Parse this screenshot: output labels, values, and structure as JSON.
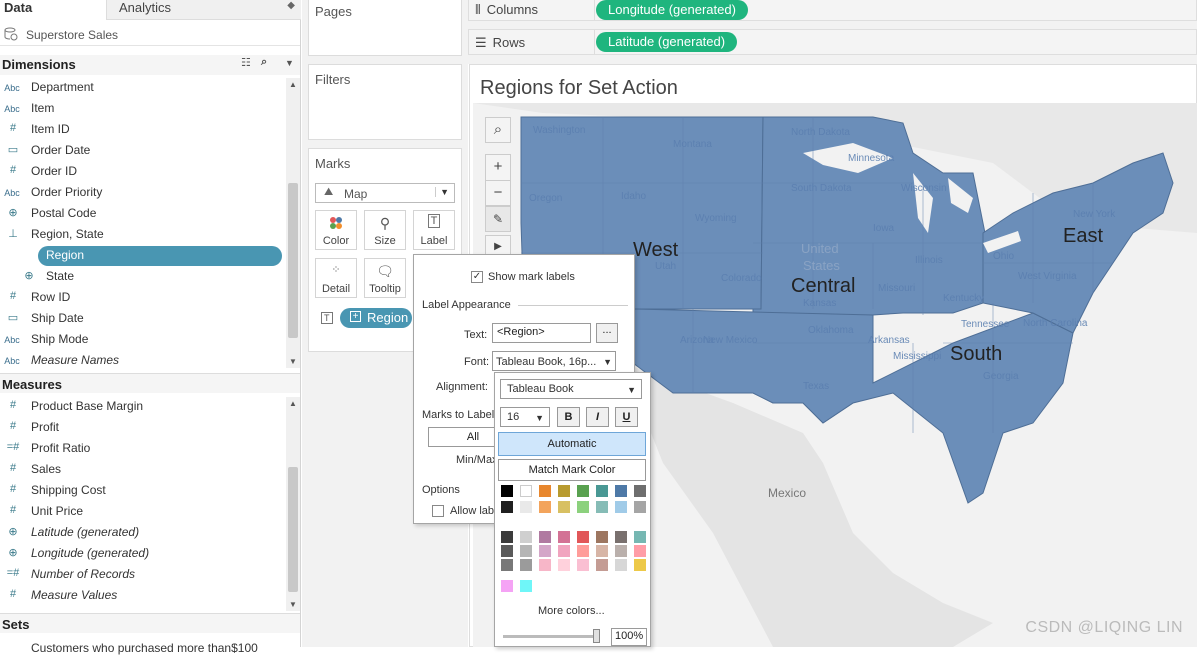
{
  "data_pane": {
    "tab_data": "Data",
    "tab_analytics": "Analytics",
    "datasource": "Superstore Sales",
    "dimensions_title": "Dimensions",
    "measures_title": "Measures",
    "sets_title": "Sets",
    "sets_item": "Customers who purchased more than$100",
    "dimensions": [
      {
        "icon": "Abc",
        "label": "Department"
      },
      {
        "icon": "Abc",
        "label": "Item"
      },
      {
        "icon": "#",
        "label": "Item ID"
      },
      {
        "icon": "date",
        "label": "Order Date"
      },
      {
        "icon": "#",
        "label": "Order ID"
      },
      {
        "icon": "Abc",
        "label": "Order Priority"
      },
      {
        "icon": "globe",
        "label": "Postal Code"
      },
      {
        "icon": "hierarchy",
        "label": "Region, State"
      },
      {
        "icon": "globe",
        "label": "Region"
      },
      {
        "icon": "globe",
        "label": "State"
      },
      {
        "icon": "#",
        "label": "Row ID"
      },
      {
        "icon": "date",
        "label": "Ship Date"
      },
      {
        "icon": "Abc",
        "label": "Ship Mode"
      },
      {
        "icon": "Abc",
        "label": "Measure Names"
      }
    ],
    "measures": [
      {
        "icon": "#",
        "label": "Product Base Margin"
      },
      {
        "icon": "#",
        "label": "Profit"
      },
      {
        "icon": "=#",
        "label": "Profit Ratio"
      },
      {
        "icon": "#",
        "label": "Sales"
      },
      {
        "icon": "#",
        "label": "Shipping Cost"
      },
      {
        "icon": "#",
        "label": "Unit Price"
      },
      {
        "icon": "globe",
        "label": "Latitude (generated)"
      },
      {
        "icon": "globe",
        "label": "Longitude (generated)"
      },
      {
        "icon": "=#",
        "label": "Number of Records"
      },
      {
        "icon": "#",
        "label": "Measure Values"
      }
    ]
  },
  "shelves": {
    "pages": "Pages",
    "filters": "Filters",
    "marks": "Marks",
    "columns_label": "Columns",
    "rows_label": "Rows",
    "columns_pill": "Longitude (generated)",
    "rows_pill": "Latitude (generated)",
    "mark_type": "Map",
    "mark_buttons": [
      "Color",
      "Size",
      "Label",
      "Detail",
      "Tooltip"
    ],
    "label_pill": "Region"
  },
  "viz": {
    "title": "Regions for Set Action",
    "regions": [
      "West",
      "Central",
      "South",
      "East"
    ],
    "center_text_1": "United",
    "center_text_2": "States",
    "mexico": "Mexico",
    "states": [
      "Washington",
      "Montana",
      "North Dakota",
      "Minnesota",
      "Oregon",
      "Idaho",
      "Wyoming",
      "South Dakota",
      "Wisconsin",
      "Iowa",
      "Illinois",
      "Utah",
      "Colorado",
      "Kansas",
      "Missouri",
      "Oklahoma",
      "Arizona",
      "New Mexico",
      "Texas",
      "Arkansas",
      "Mississippi",
      "Georgia",
      "Tennessee",
      "Kentucky",
      "North Carolina",
      "Ohio",
      "West Virginia",
      "New York"
    ]
  },
  "label_popup": {
    "show_mark_labels": "Show mark labels",
    "label_appearance": "Label Appearance",
    "text_label": "Text:",
    "text_value": "<Region>",
    "dots": "...",
    "font_label": "Font:",
    "font_value": "Tableau Book, 16p...",
    "alignment_label": "Alignment:",
    "marks_to_label": "Marks to Label",
    "all_btn": "All",
    "min_max": "Min/Max",
    "options": "Options",
    "allow_labels": "Allow lab"
  },
  "font_panel": {
    "font_family": "Tableau Book",
    "font_size": "16",
    "bold": "B",
    "italic": "I",
    "underline": "U",
    "automatic": "Automatic",
    "match_mark_color": "Match Mark Color",
    "more_colors": "More colors...",
    "opacity": "100%"
  },
  "watermark": "CSDN @LIQING LIN"
}
